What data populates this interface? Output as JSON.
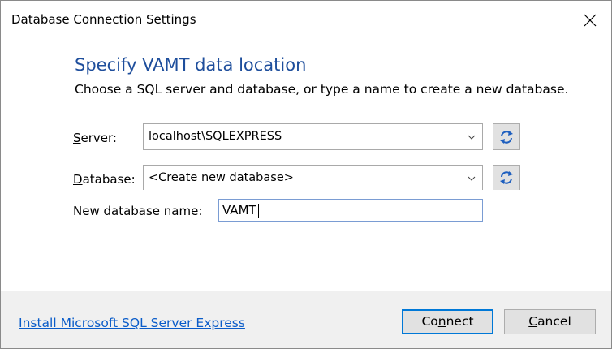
{
  "window": {
    "title": "Database Connection Settings",
    "close_glyph": "close-icon"
  },
  "header": {
    "heading": "Specify VAMT data location",
    "subheading": "Choose a SQL server and database, or type a name to create a new database."
  },
  "form": {
    "server": {
      "label_mnemonic": "S",
      "label_rest": "erver:",
      "value": "localhost\\SQLEXPRESS",
      "refresh_icon": "refresh-icon"
    },
    "database": {
      "label_mnemonic": "D",
      "label_rest": "atabase:",
      "value": "<Create new database>",
      "refresh_icon": "refresh-icon"
    },
    "new_database_name": {
      "label": "New database name:",
      "value": "VAMT"
    }
  },
  "footer": {
    "install_link": "Install Microsoft SQL Server Express",
    "connect_before": "Co",
    "connect_mnemonic": "n",
    "connect_after": "nect",
    "cancel_mnemonic": "C",
    "cancel_rest": "ancel"
  },
  "colors": {
    "heading": "#1e4e9c",
    "link": "#0a5cc9",
    "focus": "#0078d7",
    "footer_bg": "#f0f0f0"
  }
}
